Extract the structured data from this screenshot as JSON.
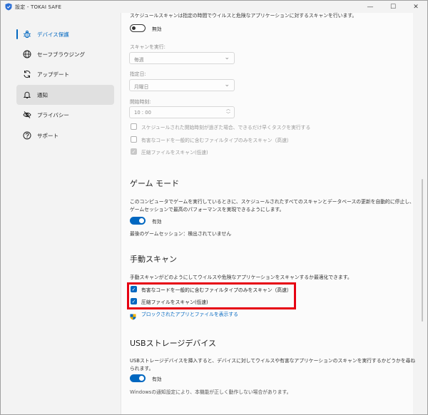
{
  "window": {
    "title": "設定 - TOKAI SAFE",
    "minimize_glyph": "—",
    "maximize_glyph": "☐",
    "close_glyph": "✕"
  },
  "colors": {
    "accent": "#0067c0",
    "highlight_border": "#e60012"
  },
  "sidebar": {
    "items": [
      {
        "label": "デバイス保護",
        "icon": "bug-icon",
        "active": true
      },
      {
        "label": "セーフブラウジング",
        "icon": "globe-icon"
      },
      {
        "label": "アップデート",
        "icon": "refresh-icon"
      },
      {
        "label": "通知",
        "icon": "bell-icon",
        "selected": true
      },
      {
        "label": "プライバシー",
        "icon": "eye-slash-icon"
      },
      {
        "label": "サポート",
        "icon": "question-icon"
      }
    ]
  },
  "scheduled_scan": {
    "description": "スケジュールスキャンは指定の時間でウイルスと危険なアプリケーションに対するスキャンを行います。",
    "toggle_label": "無効",
    "run_label": "スキャンを実行:",
    "run_value": "毎週",
    "day_label": "指定日:",
    "day_value": "月曜日",
    "time_label": "開始時刻:",
    "time_value": "10 : 00",
    "options": [
      {
        "label": "スケジュールされた開始時刻が過ぎた場合、できるだけ早くタスクを実行する",
        "checked": false
      },
      {
        "label": "有害なコードを一般的に含むファイルタイプのみをスキャン（高速）",
        "checked": false
      },
      {
        "label": "圧縮ファイルをスキャン(低速)",
        "checked": true
      }
    ]
  },
  "game_mode": {
    "heading": "ゲーム モード",
    "description_line1": "このコンピュータでゲームを実行しているときに、スケジュールされたすべてのスキャンとデータベースの更新を自動的に停止し、",
    "description_line2": "ゲームセッションで最高のパフォーマンスを実現できるようにします。",
    "toggle_label": "有効",
    "last_session": "最後のゲームセッション：検出されていません"
  },
  "manual_scan": {
    "heading": "手動スキャン",
    "description": "手動スキャンがどのようにしてウイルスや危険なアプリケーションをスキャンするか最適化できます。",
    "options": [
      {
        "label": "有害なコードを一般的に含むファイルタイプのみをスキャン（高速）",
        "checked": true
      },
      {
        "label": "圧縮ファイルをスキャン(低速)",
        "checked": true
      }
    ],
    "link": "ブロックされたアプリとファイルを表示する"
  },
  "usb": {
    "heading": "USBストレージデバイス",
    "description_line1": "USBストレージデバイスを挿入すると、デバイスに対してウイルスや有害なアプリケーションのスキャンを実行するかどうかを尋ね",
    "description_line2": "られます。",
    "toggle_label": "有効",
    "note": "Windowsの通知設定により、本機能が正しく動作しない場合があります。"
  }
}
